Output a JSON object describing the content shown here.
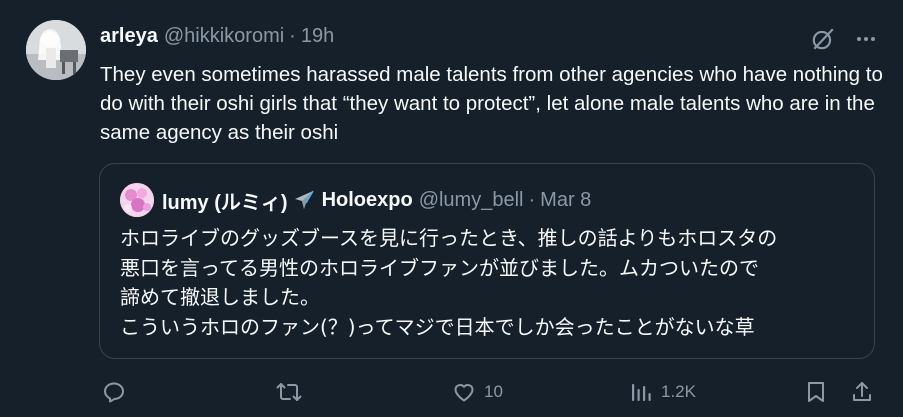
{
  "tweet": {
    "display_name": "arleya",
    "handle": "@hikkikoromi",
    "separator": "·",
    "time": "19h",
    "text": "They even sometimes harassed male talents from other agencies who have nothing to do with their oshi girls that “they want to protect”, let alone male talents who are in the same agency as their oshi"
  },
  "quote": {
    "display_name": "lumy (ルミィ)",
    "name_suffix": "Holoexpo",
    "handle": "@lumy_bell",
    "separator": "·",
    "time": "Mar 8",
    "lines": [
      "ホロライブのグッズブースを見に行ったとき、推しの話よりもホロスタの",
      "悪口を言ってる男性のホロライブファンが並びました。ムカついたので",
      "諦めて撤退しました。",
      "こういうホロのファン(？)ってマジで日本でしか会ったことがないな草"
    ]
  },
  "actions": {
    "reply_count": "",
    "retweet_count": "",
    "like_count": "10",
    "views_count": "1.2K"
  },
  "icons": {
    "grok": "grok-icon",
    "more": "more-icon",
    "reply": "reply-icon",
    "retweet": "retweet-icon",
    "like": "heart-icon",
    "views": "views-icon",
    "bookmark": "bookmark-icon",
    "share": "share-icon",
    "plane": "airplane-emoji-icon"
  },
  "colors": {
    "background": "#15202b",
    "text": "#f7f9f9",
    "muted": "#8b98a5",
    "border": "#38444d"
  }
}
